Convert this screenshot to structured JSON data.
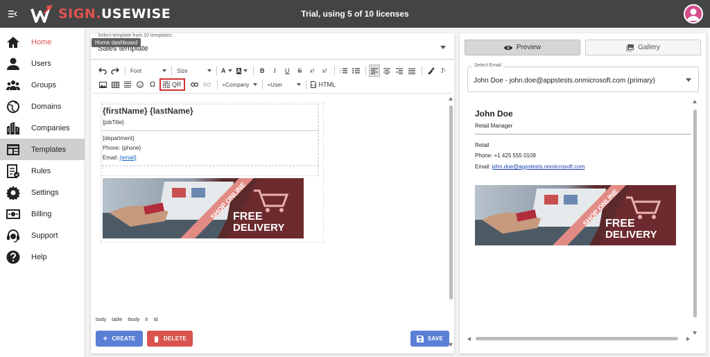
{
  "app": {
    "logo_part1": "SIGN.",
    "logo_part2": "USEWISE",
    "license_text": "Trial, using 5 of 10 licenses"
  },
  "sidebar": {
    "items": [
      {
        "label": "Home",
        "icon": "home-icon"
      },
      {
        "label": "Users",
        "icon": "user-icon"
      },
      {
        "label": "Groups",
        "icon": "groups-icon"
      },
      {
        "label": "Domains",
        "icon": "globe-icon"
      },
      {
        "label": "Companies",
        "icon": "buildings-icon"
      },
      {
        "label": "Templates",
        "icon": "template-icon"
      },
      {
        "label": "Rules",
        "icon": "rules-icon"
      },
      {
        "label": "Settings",
        "icon": "gear-icon"
      },
      {
        "label": "Billing",
        "icon": "billing-icon"
      },
      {
        "label": "Support",
        "icon": "headset-icon"
      },
      {
        "label": "Help",
        "icon": "help-icon"
      }
    ],
    "active": "Templates",
    "tooltip": "Home dashboard"
  },
  "editor": {
    "template_select_label": "Select template from 10 templates:",
    "template_select_value": "Sales template",
    "toolbar": {
      "font_label": "Font",
      "size_label": "Size",
      "qr_label": "QR",
      "company_label": "+Company",
      "user_label": "+User",
      "html_label": "HTML",
      "omega": "Ω"
    },
    "signature": {
      "name": "{firstName} {lastName}",
      "job": "{jobTitle}",
      "department": "{department}",
      "phone_prefix": "Phone: ",
      "phone": "{phone}",
      "email_prefix": "Email: ",
      "email": "{email}"
    },
    "banner": {
      "ribbon": "SHOP ONLINE",
      "line1": "FREE",
      "line2": "DELIVERY"
    },
    "path": [
      "body",
      "table",
      "tbody",
      "tr",
      "td"
    ],
    "buttons": {
      "create": "CREATE",
      "delete": "DELETE",
      "save": "SAVE"
    }
  },
  "preview": {
    "tab_preview": "Preview",
    "tab_gallery": "Gallery",
    "select_email_label": "Select Email",
    "select_email_value": "John Doe - john.doe@appstests.onmicrosoft.com (primary)",
    "name": "John Doe",
    "job": "Retail Manager",
    "department": "Retail",
    "phone": "Phone: +1 425 555 0109",
    "email_prefix": "Email: ",
    "email": "john.doe@appstests.onmicrosoft.com"
  },
  "colors": {
    "topbar": "#444444",
    "brand_red": "#e05252",
    "primary_blue": "#5b7fd6",
    "danger_red": "#d9534f",
    "banner_maroon": "#5a2a2a"
  }
}
